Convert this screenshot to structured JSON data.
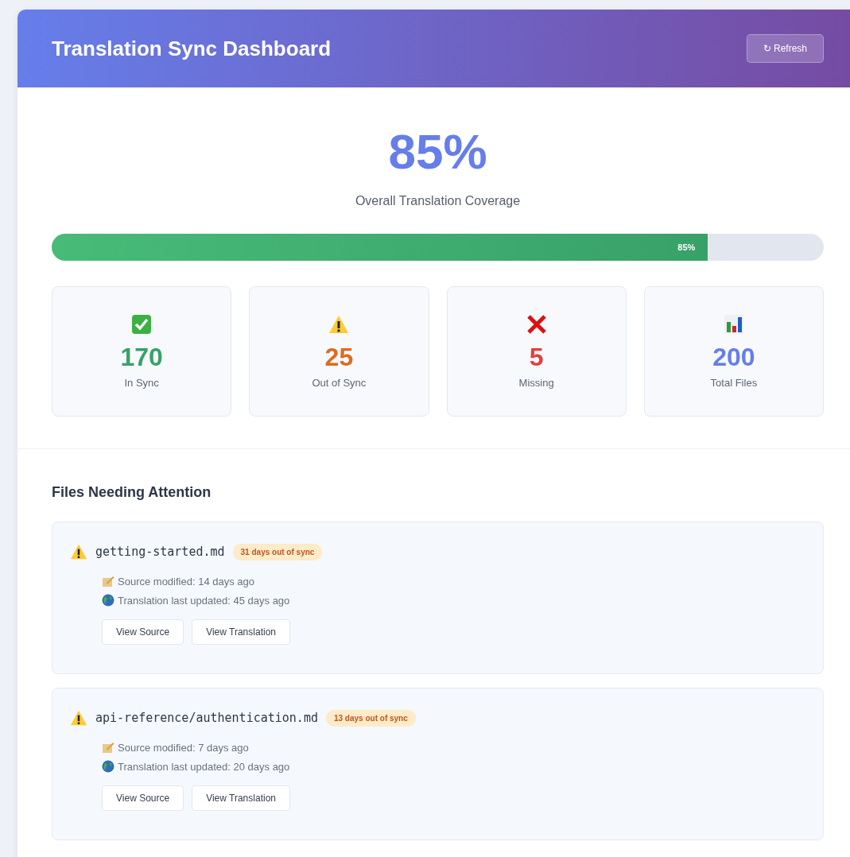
{
  "header": {
    "title": "Translation Sync Dashboard",
    "refresh_button": "↻ Refresh"
  },
  "coverage": {
    "value": "85%",
    "label": "Overall Translation Coverage",
    "level": 0.85,
    "bar_label": "85%"
  },
  "stats": [
    {
      "kind": "in_sync",
      "value": "170",
      "label": "In Sync"
    },
    {
      "kind": "out_of_sync",
      "value": "25",
      "label": "Out of Sync"
    },
    {
      "kind": "missing",
      "value": "5",
      "label": "Missing"
    },
    {
      "kind": "total",
      "value": "200",
      "label": "Total Files"
    }
  ],
  "files_section": {
    "title": "Files Needing Attention",
    "files": [
      {
        "name": "getting-started.md",
        "badge": "31 days out of sync",
        "source": "Source modified: 14 days ago",
        "translation": "Translation last updated: 45 days ago",
        "buttons": [
          "View Source",
          "View Translation"
        ]
      },
      {
        "name": "api-reference/authentication.md",
        "badge": "13 days out of sync",
        "source": "Source modified: 7 days ago",
        "translation": "Translation last updated: 20 days ago",
        "buttons": [
          "View Source",
          "View Translation"
        ]
      }
    ]
  }
}
